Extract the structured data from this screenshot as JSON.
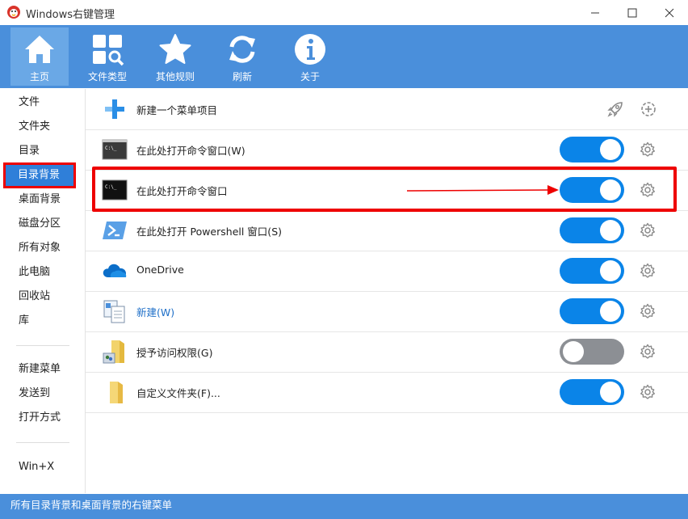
{
  "window": {
    "title": "Windows右键管理"
  },
  "toolbar": {
    "tabs": [
      {
        "label": "主页",
        "icon": "home-icon"
      },
      {
        "label": "文件类型",
        "icon": "file-types-icon"
      },
      {
        "label": "其他规则",
        "icon": "star-icon"
      },
      {
        "label": "刷新",
        "icon": "refresh-icon"
      },
      {
        "label": "关于",
        "icon": "info-icon"
      }
    ]
  },
  "sidebar": {
    "items": [
      {
        "label": "文件"
      },
      {
        "label": "文件夹"
      },
      {
        "label": "目录"
      },
      {
        "label": "目录背景"
      },
      {
        "label": "桌面背景"
      },
      {
        "label": "磁盘分区"
      },
      {
        "label": "所有对象"
      },
      {
        "label": "此电脑"
      },
      {
        "label": "回收站"
      },
      {
        "label": "库"
      },
      {
        "label": "新建菜单"
      },
      {
        "label": "发送到"
      },
      {
        "label": "打开方式"
      },
      {
        "label": "Win+X"
      }
    ],
    "selected": "目录背景"
  },
  "main": {
    "new_item_label": "新建一个菜单项目",
    "rows": [
      {
        "label": "在此处打开命令窗口(W)",
        "icon": "cmd-icon",
        "enabled": true
      },
      {
        "label": "在此处打开命令窗口",
        "icon": "cmd-icon",
        "enabled": true
      },
      {
        "label": "在此处打开 Powershell 窗口(S)",
        "icon": "powershell-icon",
        "enabled": true
      },
      {
        "label": "OneDrive",
        "icon": "onedrive-icon",
        "enabled": true
      },
      {
        "label": "新建(W)",
        "icon": "new-file-icon",
        "enabled": true
      },
      {
        "label": "授予访问权限(G)",
        "icon": "share-access-icon",
        "enabled": false
      },
      {
        "label": "自定义文件夹(F)...",
        "icon": "folder-icon",
        "enabled": true
      }
    ]
  },
  "status": {
    "text": "所有目录背景和桌面背景的右键菜单"
  },
  "colors": {
    "accent": "#4a8fdb",
    "toggle_on": "#0a84e8",
    "toggle_off": "#8c8f94",
    "highlight": "#ee0000"
  }
}
